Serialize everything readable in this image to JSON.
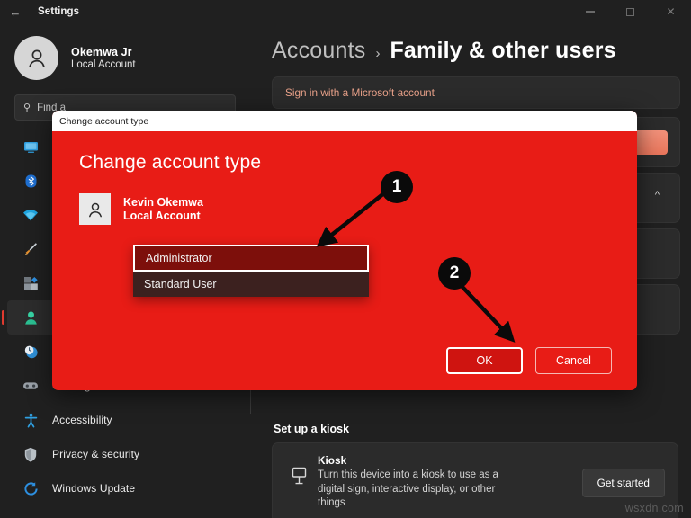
{
  "window": {
    "app_title": "Settings",
    "back_icon": "back-arrow-icon",
    "minimize_label": "Minimize",
    "maximize_label": "Maximize",
    "close_label": "Close"
  },
  "sidebar": {
    "profile": {
      "name": "Okemwa Jr",
      "subtitle": "Local Account",
      "avatar_icon": "person-avatar-icon"
    },
    "search": {
      "value": "",
      "placeholder": "Find a setting",
      "visible_text": "Find a",
      "icon": "search-icon"
    },
    "items": [
      {
        "label": "System",
        "icon": "system-display-icon",
        "selected": false,
        "glyph": "▭",
        "color": "#3aa0e0"
      },
      {
        "label": "Bluetooth & devices",
        "icon": "bluetooth-icon",
        "selected": false,
        "glyph": "ᛦ",
        "color": "#2d7fd4"
      },
      {
        "label": "Network & internet",
        "icon": "wifi-icon",
        "selected": false,
        "glyph": "▼",
        "color": "#29a8e0"
      },
      {
        "label": "Personalization",
        "icon": "paintbrush-icon",
        "selected": false,
        "glyph": "╱",
        "color": "#e08a34"
      },
      {
        "label": "Apps",
        "icon": "apps-grid-icon",
        "selected": false,
        "glyph": "▦",
        "color": "#9aa3ad"
      },
      {
        "label": "Accounts",
        "icon": "accounts-person-icon",
        "selected": true,
        "glyph": "●",
        "color": "#3ed6a8"
      },
      {
        "label": "Time & language",
        "icon": "clock-globe-icon",
        "selected": false,
        "glyph": "◔",
        "color": "#4aa8e8"
      },
      {
        "label": "Gaming",
        "icon": "gamepad-icon",
        "selected": false,
        "glyph": "⊞",
        "color": "#a9b0b8"
      },
      {
        "label": "Accessibility",
        "icon": "accessibility-icon",
        "selected": false,
        "glyph": "✳",
        "color": "#3aa0e0"
      },
      {
        "label": "Privacy & security",
        "icon": "shield-icon",
        "selected": false,
        "glyph": "⛨",
        "color": "#b6bcc2"
      },
      {
        "label": "Windows Update",
        "icon": "update-refresh-icon",
        "selected": false,
        "glyph": "⟳",
        "color": "#2d8fe0"
      }
    ]
  },
  "main": {
    "breadcrumb": {
      "parent": "Accounts",
      "separator": "›",
      "current": "Family & other users"
    },
    "microsoft_account_link": "Sign in with a Microsoft account",
    "expander_icon": "chevron-up-icon",
    "kiosk_section_label": "Set up a kiosk",
    "kiosk": {
      "icon": "kiosk-display-icon",
      "title": "Kiosk",
      "description": "Turn this device into a kiosk to use as a digital sign, interactive display, or other things",
      "button_label": "Get started"
    }
  },
  "dialog": {
    "titlebar_text": "Change account type",
    "heading": "Change account type",
    "user": {
      "name": "Kevin Okemwa",
      "subtitle": "Local Account",
      "avatar_icon": "person-avatar-icon"
    },
    "account_type_dropdown": {
      "name": "account-type-select",
      "selected": "Administrator",
      "options": [
        "Administrator",
        "Standard User"
      ]
    },
    "ok_label": "OK",
    "cancel_label": "Cancel",
    "background_color": "#e81c16"
  },
  "annotations": {
    "badge_1": "1",
    "badge_2": "2"
  },
  "watermark": "wsxdn.com"
}
